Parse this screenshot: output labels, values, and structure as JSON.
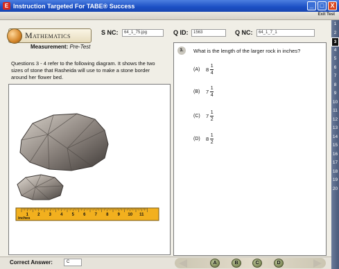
{
  "window": {
    "title": "Instruction Targeted For TABE® Success",
    "app_icon": "E",
    "controls": [
      "_",
      "□",
      "X"
    ],
    "exit_label": "Exit Test"
  },
  "header": {
    "subject": "Mathematics",
    "s_nc_label": "S NC:",
    "s_nc_value": "64_1_75.jpg",
    "q_id_label": "Q ID:",
    "q_id_value": "1563",
    "q_nc_label": "Q NC:",
    "q_nc_value": "64_1_7_1",
    "section": "Measurement:",
    "mode": "Pre-Test"
  },
  "passage": {
    "text": "Questions 3 - 4 refer to the following diagram. It shows the two sizes of stone that Rasheida will use to make a stone border around her flower bed."
  },
  "diagram": {
    "ruler_unit": "inches",
    "ruler_ticks": [
      "1",
      "2",
      "3",
      "4",
      "5",
      "6",
      "7",
      "8",
      "9",
      "10",
      "11"
    ]
  },
  "question": {
    "number": "3.",
    "text": "What is the length of the larger rock in inches?",
    "choices": [
      {
        "letter": "(A)",
        "whole": "8",
        "num": "1",
        "den": "4"
      },
      {
        "letter": "(B)",
        "whole": "7",
        "num": "1",
        "den": "4"
      },
      {
        "letter": "(C)",
        "whole": "7",
        "num": "1",
        "den": "2"
      },
      {
        "letter": "(D)",
        "whole": "8",
        "num": "1",
        "den": "2"
      }
    ]
  },
  "question_numbers": [
    "1",
    "2",
    "3",
    "4",
    "5",
    "6",
    "7",
    "8",
    "9",
    "10",
    "11",
    "12",
    "13",
    "14",
    "15",
    "16",
    "17",
    "18",
    "19",
    "20"
  ],
  "active_question": 3,
  "footer": {
    "correct_answer_label": "Correct Answer:",
    "correct_answer_value": "C",
    "answer_buttons": [
      "A",
      "B",
      "C",
      "D"
    ]
  }
}
